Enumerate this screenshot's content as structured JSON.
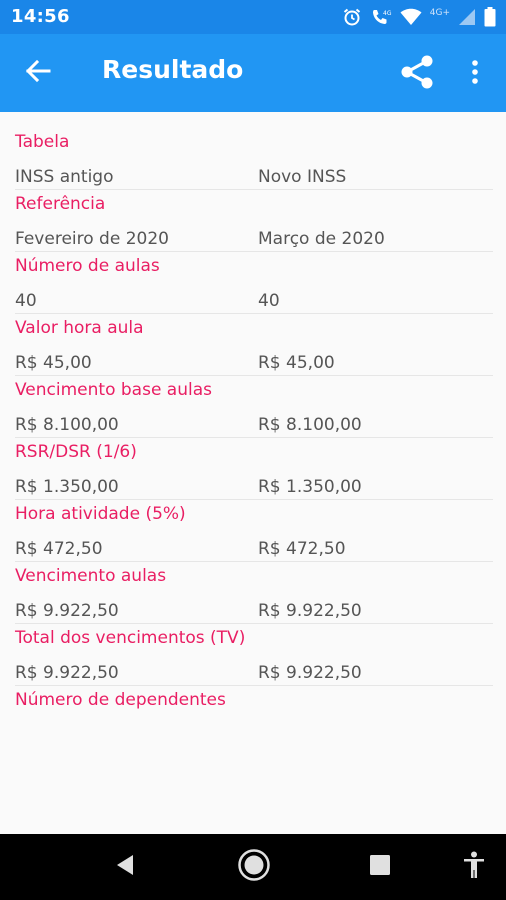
{
  "status_bar": {
    "time": "14:56",
    "network_label": "4G+",
    "icons": [
      "alarm-icon",
      "volte-call-icon",
      "wifi-icon",
      "cell-signal-icon",
      "battery-icon"
    ]
  },
  "app_bar": {
    "title": "Resultado",
    "background_color": "#2196f3",
    "status_color": "#1a86e8"
  },
  "accent_color": "#e91e63",
  "results": [
    {
      "label": "Tabela",
      "left": "INSS antigo",
      "right": "Novo INSS"
    },
    {
      "label": "Referência",
      "left": "Fevereiro de 2020",
      "right": "Março de 2020"
    },
    {
      "label": "Número de aulas",
      "left": "40",
      "right": "40"
    },
    {
      "label": "Valor hora aula",
      "left": "R$ 45,00",
      "right": "R$ 45,00"
    },
    {
      "label": "Vencimento base aulas",
      "left": "R$ 8.100,00",
      "right": "R$ 8.100,00"
    },
    {
      "label": "RSR/DSR (1/6)",
      "left": "R$ 1.350,00",
      "right": "R$ 1.350,00"
    },
    {
      "label": "Hora atividade (5%)",
      "left": "R$ 472,50",
      "right": "R$ 472,50"
    },
    {
      "label": "Vencimento aulas",
      "left": "R$ 9.922,50",
      "right": "R$ 9.922,50"
    },
    {
      "label": "Total dos vencimentos (TV)",
      "left": "R$ 9.922,50",
      "right": "R$ 9.922,50"
    },
    {
      "label": "Número de dependentes"
    }
  ],
  "nav_bar": {
    "buttons": [
      "back-triangle-icon",
      "home-circle-icon",
      "recents-square-icon",
      "accessibility-icon"
    ]
  }
}
